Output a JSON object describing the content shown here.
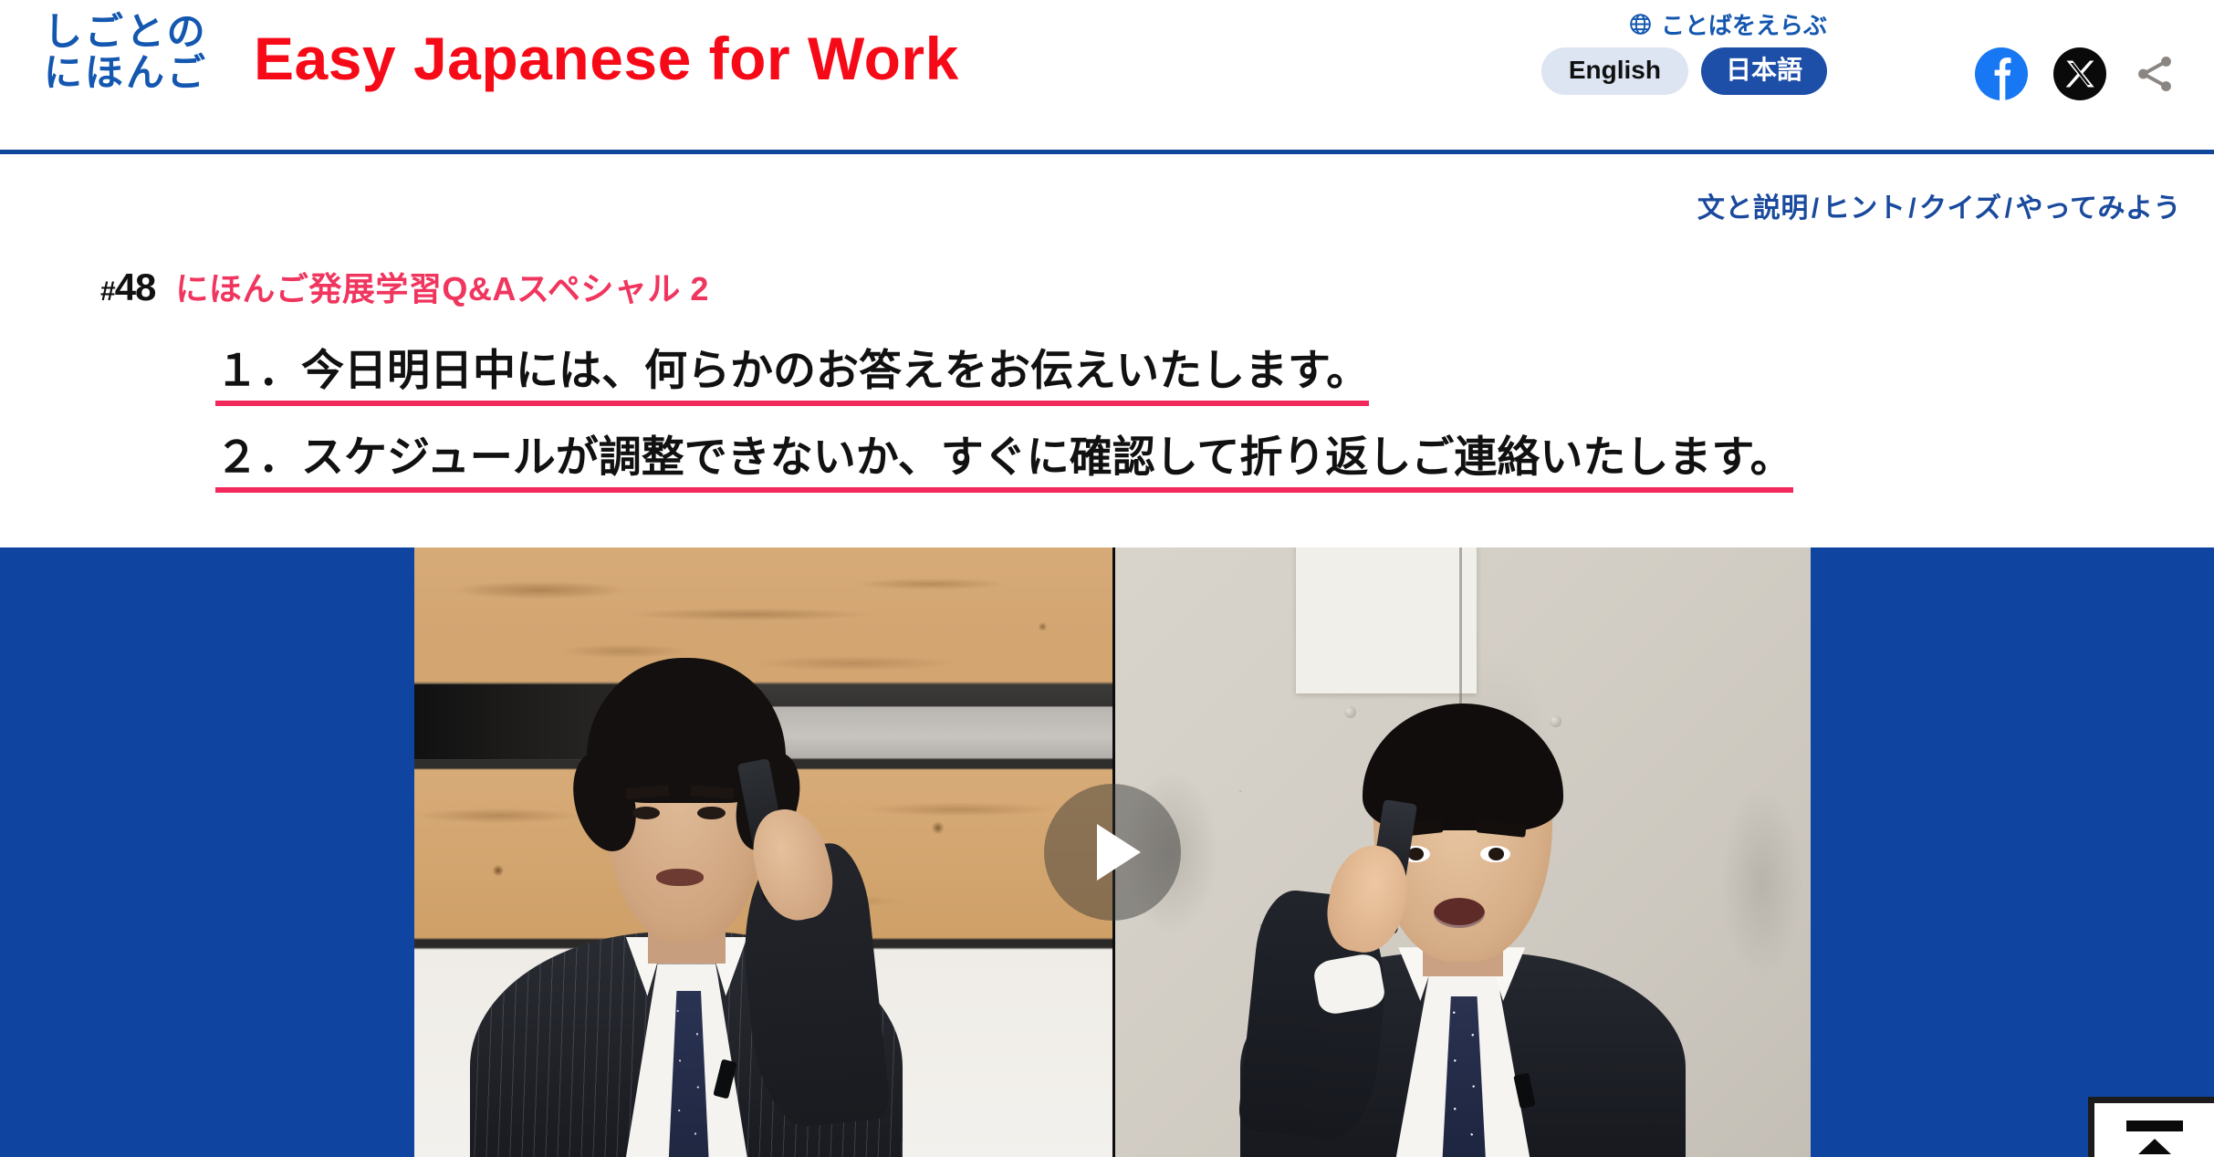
{
  "header": {
    "logo_line1": "しごとの",
    "logo_line2": "にほんご",
    "site_title": "Easy Japanese for Work",
    "language_label": "ことばをえらぶ",
    "lang_english": "English",
    "lang_japanese": "日本語",
    "globe_icon": "globe-icon",
    "facebook_icon": "facebook-icon",
    "x_icon": "x-twitter-icon",
    "share_icon": "share-icon",
    "accent_blue": "#11459C",
    "title_red": "#F60A18",
    "active_lang_bg": "#1D4EA8",
    "inactive_lang_bg": "#DDE5F2"
  },
  "breadcrumb": {
    "items": [
      "文と説明",
      "ヒント",
      "クイズ",
      "やってみよう"
    ],
    "separator": "/",
    "color": "#1A4A9E"
  },
  "episode": {
    "hash": "#",
    "number": "48",
    "title": "にほんご発展学習Q&Aスペシャル 2",
    "title_color": "#F0355E"
  },
  "sentences": [
    "１．今日明日中には、何らかのお答えをお伝えいたします。",
    "２．スケジュールが調整できないか、すぐに確認して折り返しご連絡いたします。"
  ],
  "sentence_underline_color": "#F2295B",
  "video": {
    "band_color": "#0F45A0",
    "play_icon": "play-icon",
    "left_panel_desc": "man with curly hair talking on mobile phone in front of plywood wall",
    "right_panel_desc": "young man in suit talking on mobile phone in front of concrete wall"
  },
  "scroll_top": {
    "icon": "scroll-to-top-icon"
  }
}
